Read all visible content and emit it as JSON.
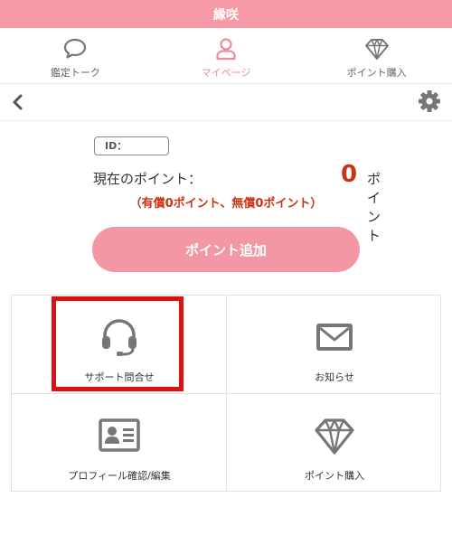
{
  "header": {
    "title": "縁咲"
  },
  "nav": {
    "items": [
      {
        "label": "鑑定トーク",
        "icon": "speech-bubble-icon"
      },
      {
        "label": "マイページ",
        "icon": "person-icon"
      },
      {
        "label": "ポイント購入",
        "icon": "diamond-icon"
      }
    ],
    "active_color": "#f08a9a"
  },
  "account": {
    "id_label": "ID："
  },
  "points": {
    "label": "現在のポイント：",
    "value": "0",
    "unit": "ポイント",
    "detail": "（有償0ポイント、無償0ポイント）"
  },
  "actions": {
    "add_points_label": "ポイント追加"
  },
  "menu": {
    "items": [
      {
        "label": "サポート問合せ",
        "icon": "headset-icon"
      },
      {
        "label": "お知らせ",
        "icon": "envelope-icon"
      },
      {
        "label": "プロフィール確認/編集",
        "icon": "profile-card-icon"
      },
      {
        "label": "ポイント購入",
        "icon": "diamond-icon"
      }
    ]
  },
  "colors": {
    "brand": "#f79aa8",
    "button": "#f497a5",
    "points_accent": "#cc3311",
    "highlight": "#dd1111",
    "icon": "#777777"
  }
}
